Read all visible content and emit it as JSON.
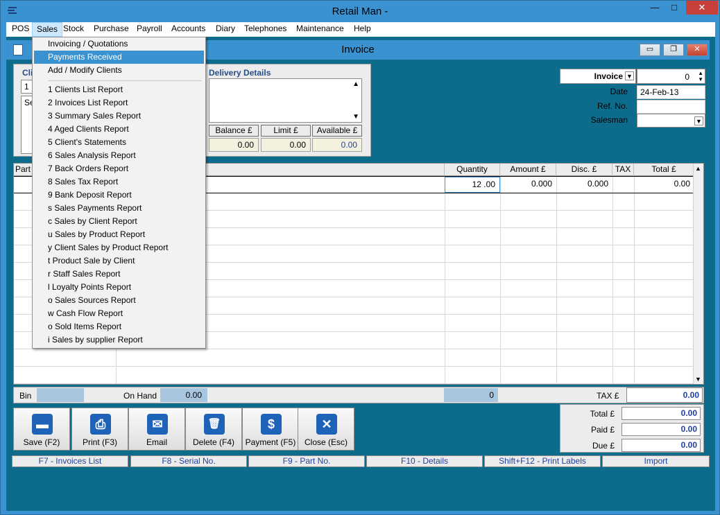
{
  "window": {
    "title": "Retail Man -",
    "min": "—",
    "max": "□",
    "close": "✕"
  },
  "menubar": [
    "POS",
    "Sales",
    "Stock",
    "Purchase",
    "Payroll",
    "Accounts",
    "Diary",
    "Telephones",
    "Maintenance",
    "Help"
  ],
  "doc": {
    "title": "Invoice",
    "min": "▭",
    "restore": "❐",
    "close": "✕"
  },
  "client_panel": {
    "client_label": "Cli",
    "client_field": "1",
    "address_fragment": "Se",
    "delivery_label": "Delivery Details",
    "balance_headers": [
      "Balance £",
      "Limit £",
      "Available £"
    ],
    "balance_values": [
      "0.00",
      "0.00",
      "0.00"
    ]
  },
  "invoice_info": {
    "type_label": "Invoice",
    "number": "0",
    "date_label": "Date",
    "date_value": "24-Feb-13",
    "ref_label": "Ref. No.",
    "salesman_label": "Salesman"
  },
  "grid": {
    "headers": [
      "Part",
      "Quantity",
      "Amount £",
      "Disc. £",
      "TAX",
      "Total £"
    ],
    "row1": {
      "quantity": "12 .00",
      "amount": "0.000",
      "disc": "0.000",
      "total": "0.00"
    }
  },
  "status": {
    "bin_label": "Bin",
    "onhand_label": "On Hand",
    "onhand_value": "0.00",
    "qty_total": "0",
    "tax_label": "TAX £",
    "tax_value": "0.00"
  },
  "buttons": [
    {
      "label": "Save (F2)",
      "glyph": "▬"
    },
    {
      "label": "Print (F3)",
      "glyph": "⎙"
    },
    {
      "label": "Email",
      "glyph": "✉"
    },
    {
      "label": "Delete (F4)",
      "glyph": "🗑"
    },
    {
      "label": "Payment (F5)",
      "glyph": "$"
    },
    {
      "label": "Close (Esc)",
      "glyph": "✕"
    }
  ],
  "totals": {
    "total_label": "Total £",
    "total_value": "0.00",
    "paid_label": "Paid £",
    "paid_value": "0.00",
    "due_label": "Due £",
    "due_value": "0.00"
  },
  "fkeys": [
    "F7 - Invoices List",
    "F8 - Serial No.",
    "F9 - Part No.",
    "F10 - Details",
    "Shift+F12 - Print Labels",
    "Import"
  ],
  "sales_menu": {
    "top": [
      "Invoicing / Quotations",
      "Payments Received",
      "Add / Modify Clients"
    ],
    "reports": [
      "1 Clients List Report",
      "2 Invoices List Report",
      "3 Summary Sales Report",
      "4 Aged Clients Report",
      "5 Client's Statements",
      "6 Sales Analysis Report",
      "7 Back Orders Report",
      "8 Sales Tax Report",
      "9 Bank Deposit Report",
      "s Sales Payments Report",
      "c Sales by Client Report",
      "u Sales by Product Report",
      "y Client Sales by Product Report",
      "t Product Sale by Client",
      "r Staff Sales Report",
      "l Loyalty Points Report",
      "o Sales Sources Report",
      "w Cash Flow Report",
      "o Sold Items Report",
      "i Sales by supplier Report"
    ]
  },
  "colors": {
    "accent": "#3a93d0",
    "mdi_bg": "#0d6b8c",
    "value_blue": "#1f3fa0"
  }
}
